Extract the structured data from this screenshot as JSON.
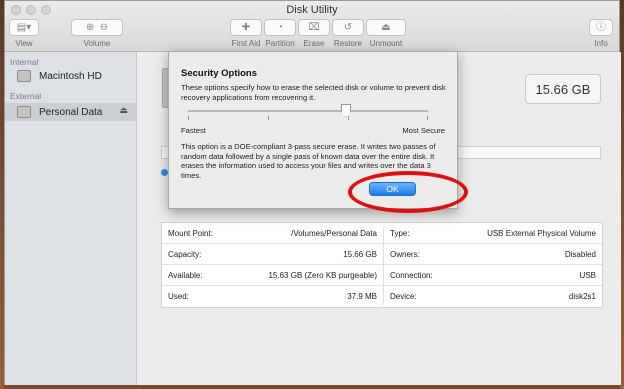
{
  "window": {
    "title": "Disk Utility"
  },
  "toolbar": {
    "view_label": "View",
    "volume_label": "Volume",
    "first_aid_label": "First Aid",
    "partition_label": "Partition",
    "erase_label": "Erase",
    "restore_label": "Restore",
    "unmount_label": "Unmount",
    "info_label": "Info"
  },
  "sidebar": {
    "internal_header": "Internal",
    "external_header": "External",
    "items": [
      {
        "label": "Macintosh HD"
      },
      {
        "label": "Personal Data",
        "selected": true
      }
    ],
    "eject_glyph": "⏏"
  },
  "main": {
    "capacity_display": "15.66 GB",
    "paren_fragment": ")",
    "info_left": [
      {
        "key": "Mount Point:",
        "value": "/Volumes/Personal Data"
      },
      {
        "key": "Capacity:",
        "value": "15.66 GB"
      },
      {
        "key": "Available:",
        "value": "15.63 GB (Zero KB purgeable)"
      },
      {
        "key": "Used:",
        "value": "37.9 MB"
      }
    ],
    "info_right": [
      {
        "key": "Type:",
        "value": "USB External Physical Volume"
      },
      {
        "key": "Owners:",
        "value": "Disabled"
      },
      {
        "key": "Connection:",
        "value": "USB"
      },
      {
        "key": "Device:",
        "value": "disk2s1"
      }
    ]
  },
  "dialog": {
    "title": "Security Options",
    "description": "These options specify how to erase the selected disk or volume to prevent disk recovery applications from recovering it.",
    "min_label": "Fastest",
    "max_label": "Most Secure",
    "slider_position_fraction": 0.67,
    "option_description": "This option is a DOE-compliant 3-pass secure erase. It writes two passes of random data followed by a single pass of known data over the entire disk. It erases the information used to access your files and writes over the data 3 times.",
    "ok_label": "OK"
  },
  "annotation": {
    "color": "#e01010"
  },
  "colors": {
    "accent": "#1b7de9",
    "sidebar_selected": "#cbcfd4"
  }
}
